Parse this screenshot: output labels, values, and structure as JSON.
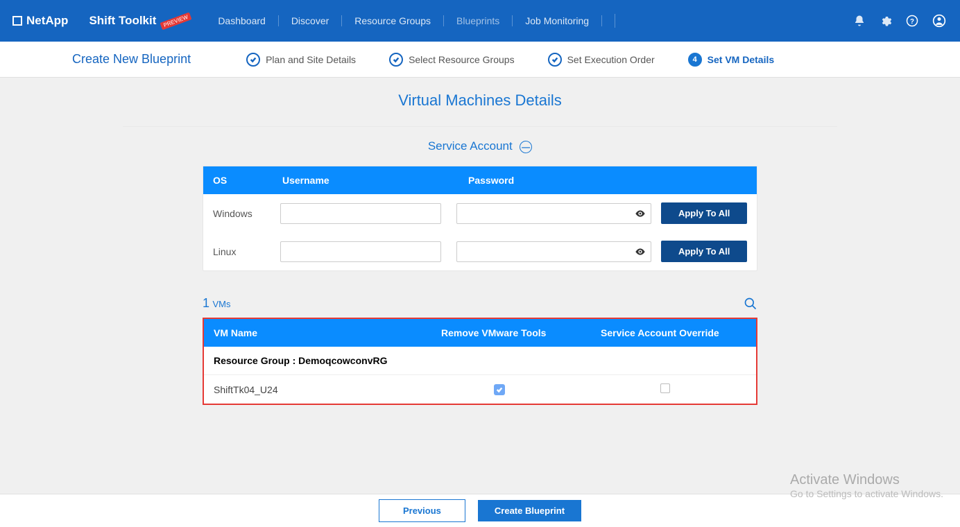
{
  "header": {
    "brand": "NetApp",
    "product": "Shift Toolkit",
    "preview_badge": "PREVIEW",
    "nav": [
      "Dashboard",
      "Discover",
      "Resource Groups",
      "Blueprints",
      "Job Monitoring"
    ],
    "active_nav_index": 3
  },
  "stepper": {
    "title": "Create New Blueprint",
    "steps": [
      {
        "label": "Plan and Site Details",
        "state": "done"
      },
      {
        "label": "Select Resource Groups",
        "state": "done"
      },
      {
        "label": "Set Execution Order",
        "state": "done"
      },
      {
        "label": "Set VM Details",
        "state": "active",
        "num": "4"
      }
    ]
  },
  "main": {
    "title": "Virtual Machines Details",
    "section_title": "Service Account"
  },
  "sa_table": {
    "col_os": "OS",
    "col_user": "Username",
    "col_pass": "Password",
    "rows": [
      {
        "os": "Windows",
        "apply": "Apply To All"
      },
      {
        "os": "Linux",
        "apply": "Apply To All"
      }
    ]
  },
  "vms": {
    "count": "1",
    "label": "VMs",
    "col_name": "VM Name",
    "col_tools": "Remove VMware Tools",
    "col_override": "Service Account Override",
    "group_label": "Resource Group : DemoqcowconvRG",
    "row": {
      "name": "ShiftTk04_U24",
      "tools_checked": true,
      "override_checked": false
    }
  },
  "footer": {
    "prev": "Previous",
    "create": "Create Blueprint"
  },
  "watermark": {
    "title": "Activate Windows",
    "sub": "Go to Settings to activate Windows."
  }
}
